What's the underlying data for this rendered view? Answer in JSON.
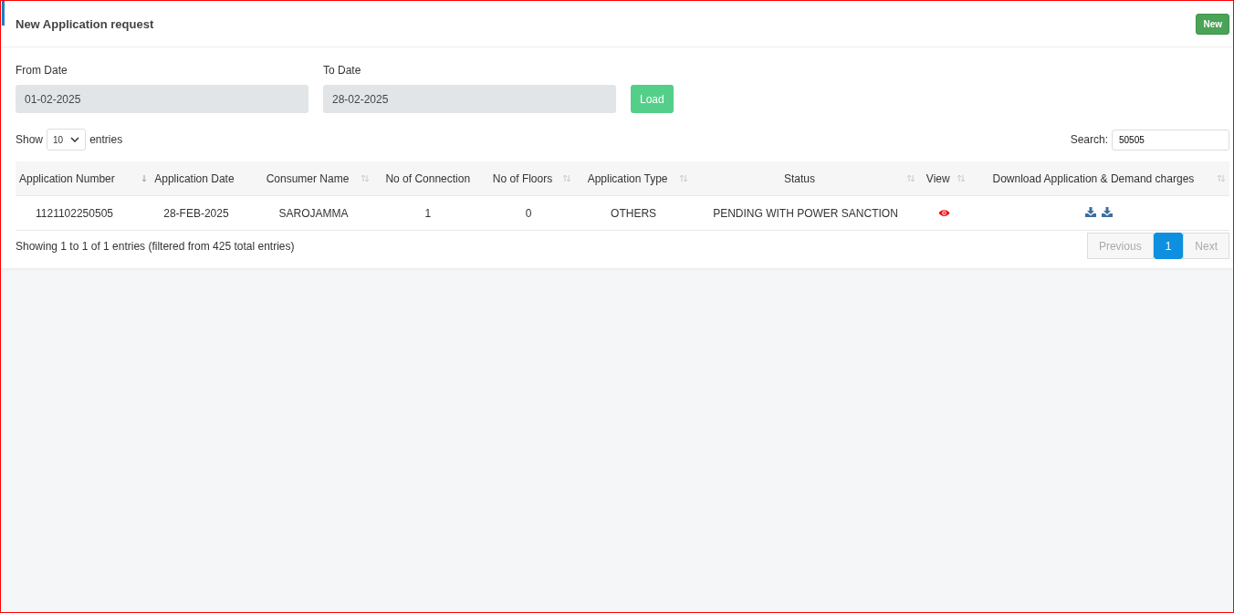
{
  "header": {
    "title": "New Application request",
    "new_button": "New"
  },
  "filters": {
    "from": {
      "label": "From Date",
      "value": "01-02-2025"
    },
    "to": {
      "label": "To Date",
      "value": "28-02-2025"
    },
    "load_button": "Load"
  },
  "length": {
    "show": "Show",
    "value": "10",
    "entries": "entries"
  },
  "search": {
    "label": "Search:",
    "value": "50505"
  },
  "table": {
    "columns": [
      {
        "label": "Application Number",
        "kind": "sorted",
        "centered": false
      },
      {
        "label": "Application Date",
        "kind": "plain",
        "centered": false
      },
      {
        "label": "Consumer Name",
        "kind": "sortable",
        "centered": true
      },
      {
        "label": "No of Connection",
        "kind": "plain",
        "centered": true
      },
      {
        "label": "No of Floors",
        "kind": "sortable",
        "centered": true
      },
      {
        "label": "Application Type",
        "kind": "sortable",
        "centered": true
      },
      {
        "label": "Status",
        "kind": "sortable",
        "centered": true
      },
      {
        "label": "View",
        "kind": "sortable",
        "centered": true
      },
      {
        "label": "Download Application & Demand charges",
        "kind": "sortable",
        "centered": true
      }
    ],
    "rows": [
      {
        "cells": [
          "1121102250505",
          "28-FEB-2025",
          "SAROJAMMA",
          "1",
          "0",
          "OTHERS",
          "PENDING WITH POWER SANCTION"
        ]
      }
    ]
  },
  "info": "Showing 1 to 1 of 1 entries (filtered from 425 total entries)",
  "pagination": {
    "previous": {
      "label": "Previous",
      "disabled": true
    },
    "pages": [
      {
        "label": "1",
        "selected": true
      }
    ],
    "next": {
      "label": "Next",
      "disabled": true
    }
  }
}
